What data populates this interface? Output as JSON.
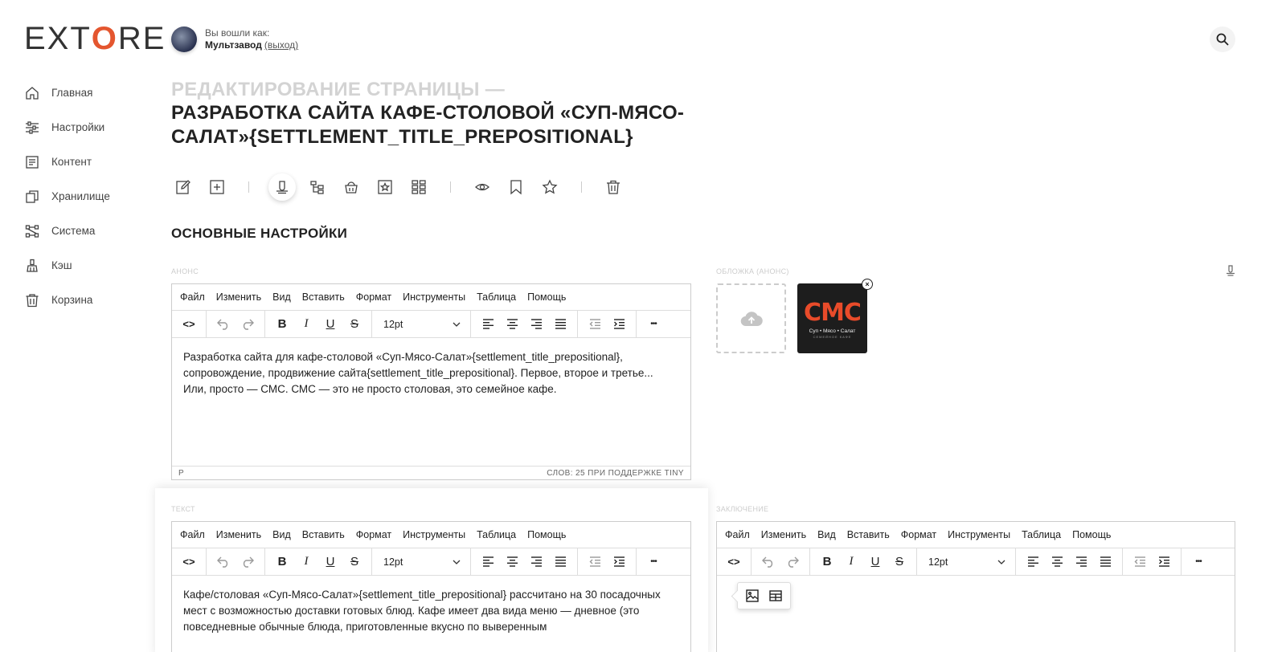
{
  "brand": {
    "logo_left": "EXT",
    "logo_o": "O",
    "logo_right": "RE"
  },
  "user": {
    "prefix": "Вы вошли как:",
    "name": "Мультзавод",
    "logout": "(выход)"
  },
  "nav": [
    {
      "label": "Главная",
      "icon": "home-icon"
    },
    {
      "label": "Настройки",
      "icon": "sliders-icon"
    },
    {
      "label": "Контент",
      "icon": "content-icon"
    },
    {
      "label": "Хранилище",
      "icon": "copy-icon"
    },
    {
      "label": "Система",
      "icon": "system-icon"
    },
    {
      "label": "Кэш",
      "icon": "broom-icon"
    },
    {
      "label": "Корзина",
      "icon": "trash-icon"
    }
  ],
  "page": {
    "title_prefix": "РЕДАКТИРОВАНИЕ СТРАНИЦЫ —",
    "title": "РАЗРАБОТКА САЙТА КАФЕ-СТОЛОВОЙ «СУП-МЯСО-САЛАТ»{SETTLEMENT_TITLE_PREPOSITIONAL}",
    "section": "ОСНОВНЫЕ НАСТРОЙКИ"
  },
  "labels": {
    "anons": "АНОНС",
    "cover": "ОБЛОЖКА (АНОНС)",
    "text": "ТЕКСТ",
    "conclusion": "ЗАКЛЮЧЕНИЕ"
  },
  "editor": {
    "menu": [
      "Файл",
      "Изменить",
      "Вид",
      "Вставить",
      "Формат",
      "Инструменты",
      "Таблица",
      "Помощь"
    ],
    "font_size": "12pt",
    "bold": "B",
    "italic": "I",
    "underline": "U",
    "strike": "S",
    "more": "•••",
    "code": "<>"
  },
  "anons_editor": {
    "content": "Разработка сайта для кафе-столовой «Суп-Мясо-Салат»{settlement_title_prepositional}, сопровождение, продвижение сайта{settlement_title_prepositional}. Первое, второе и третье... Или, просто — СМС. СМС — это не просто столовая, это семейное кафе.",
    "path": "P",
    "status": "СЛОВ: 25   ПРИ ПОДДЕРЖКЕ TINY"
  },
  "text_editor": {
    "content": "Кафе/столовая «Суп-Мясо-Салат»{settlement_title_prepositional} рассчитано на 30 посадочных мест с возможностью доставки готовых блюд. Кафе имеет два вида меню — дневное (это повседневные обычные блюда, приготовленные вкусно по выверенным"
  },
  "cover": {
    "logo_text": "СМС",
    "tagline": "Суп • Мясо • Салат",
    "subline": "СЕМЕЙНОЕ КАФЕ",
    "remove": "×"
  },
  "colors": {
    "accent": "#e4562f",
    "cover_bg": "#1d1d1d",
    "title_muted": "#d3d3d3"
  }
}
